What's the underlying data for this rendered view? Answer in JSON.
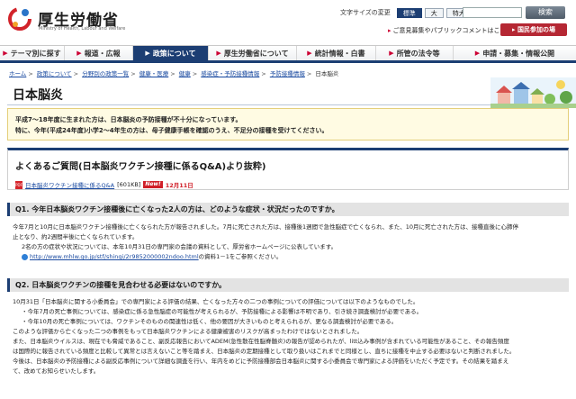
{
  "header": {
    "logo_title": "厚生労働省",
    "logo_sub": "Ministry of Health, Labour and Welfare",
    "fontsize_label": "文字サイズの変更",
    "fontsize_options": [
      "標準",
      "大",
      "特大"
    ],
    "search_placeholder": "",
    "search_button": "検索",
    "opinion_link": "ご意見募集やパブリックコメントはこちら",
    "participate_button": "国民参加の場"
  },
  "nav": {
    "items": [
      {
        "label": "テーマ別に探す",
        "active": false
      },
      {
        "label": "報道・広報",
        "active": false
      },
      {
        "label": "政策について",
        "active": true
      },
      {
        "label": "厚生労働省について",
        "active": false
      },
      {
        "label": "統計情報・白書",
        "active": false
      },
      {
        "label": "所管の法令等",
        "active": false
      },
      {
        "label": "申請・募集・情報公開",
        "active": false
      }
    ]
  },
  "breadcrumb": [
    "ホーム",
    "政策について",
    "分野別の政策一覧",
    "健康・医療",
    "健康",
    "感染症・予防接種情報",
    "予防接種情報",
    "日本脳炎"
  ],
  "page_title": "日本脳炎",
  "notice": [
    "平成7～18年度に生まれた方は、日本脳炎の予防接種が不十分になっています。",
    "特に、今年(平成24年度)小学2～4年生の方は、母子健康手帳を確認のうえ、不足分の接種を受けてください。"
  ],
  "faq": {
    "title": "よくあるご質問(日本脳炎ワクチン接種に係るQ&A)より抜粋)",
    "pdf_link": "日本脳炎ワクチン接種に係るQ&A",
    "pdf_size": "[601KB]",
    "new_badge": "New!",
    "new_date": "12月11日"
  },
  "q1": {
    "question": "Q1. 今年日本脳炎ワクチン接種後に亡くなった2人の方は、どのような症状・状況だったのですか。",
    "answer": [
      "今年7月と10月に日本脳炎ワクチン接種後に亡くなられた方が報告されました。7月に死亡された方は、接種後1週間で急性脳症で亡くなられ、また、10月に死亡された方は、接種直後に心肺停",
      "止となり、約2週間半後に亡くなられています。",
      "2名の方の症状や状況については、本年10月31日の専門家の会議の資料として、厚労省ホームページに公表しています。"
    ],
    "url": "http://www.mhlw.go.jp/stf/shingi/2r9852000002ndoo.html",
    "url_suffix": "の資料1－1をご参照ください。"
  },
  "q2": {
    "question": "Q2. 日本脳炎ワクチンの接種を見合わせる必要はないのですか。",
    "answer": [
      "10月31日「日本脳炎に関する小委員会」での専門家による評価の結果、亡くなった方々の二つの事例についての評価については以下のようなものでした。",
      "・今年7月の死亡事例については、感染症に係る急性脳症の可能性が考えられるが、予防接種による影響は不明であり、引き続き調査検討が必要である。",
      "・今年10月の死亡事例については、ワクチンそのものの関連性は低く、他の要因が大きいものと考えられるが、更なる調査検討が必要である。",
      "このような評価から亡くなった二つの事例をもって日本脳炎ワクチンによる健康被害のリスクが高まったわけではないとされました。",
      "また、日本脳炎ウイルスは、現在でも脅威であること、副反応報告においてADEM(急性散在性脳脊髄炎)の報告が認められたが、litt込み事例が含まれている可能性があること、その報告頻度",
      "は国際的に報告されている頻度と比較して異常とは言えないこと等を踏まえ、日本脳炎の定期接種として取り扱いはこれまでと同様とし、直ちに接種を中止する必要はないと判断されました。",
      "今後は、日本脳炎の予防接種による副反応事例について詳細な調査を行い、年内をめどに予防接種部会日本脳炎に関する小委員会で専門家による評価をいただく予定です。その結果を踏まえ",
      "て、改めてお知らせいたします。"
    ]
  },
  "colors": {
    "nav_active": "#1c3e73",
    "participate": "#b52733",
    "new_badge": "#d01f28",
    "link": "#1a4aa0",
    "notice_bg": "#fffbe3"
  }
}
